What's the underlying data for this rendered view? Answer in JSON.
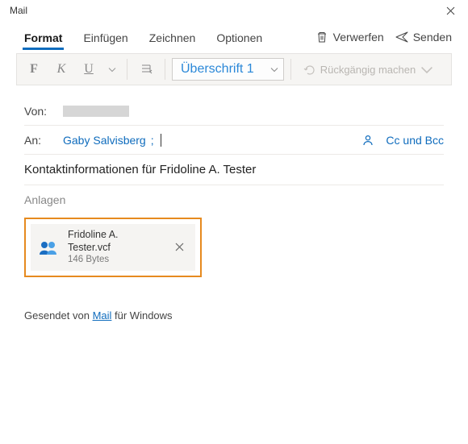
{
  "window": {
    "title": "Mail"
  },
  "tabs": {
    "format": "Format",
    "insert": "Einfügen",
    "draw": "Zeichnen",
    "options": "Optionen"
  },
  "actions": {
    "discard": "Verwerfen",
    "send": "Senden"
  },
  "ribbon": {
    "bold": "F",
    "italic": "K",
    "underline": "U",
    "heading": "Überschrift 1",
    "undo": "Rückgängig machen"
  },
  "fields": {
    "from_label": "Von:",
    "to_label": "An:",
    "recipient": "Gaby Salvisberg",
    "ccbcc": "Cc und Bcc",
    "subject": "Kontaktinformationen für Fridoline A. Tester",
    "attachments_label": "Anlagen"
  },
  "attachment": {
    "name": "Fridoline A. Tester.vcf",
    "size": "146 Bytes"
  },
  "body": {
    "sent_from_prefix": "Gesendet von ",
    "sent_from_app": "Mail",
    "sent_from_suffix": " für Windows"
  }
}
